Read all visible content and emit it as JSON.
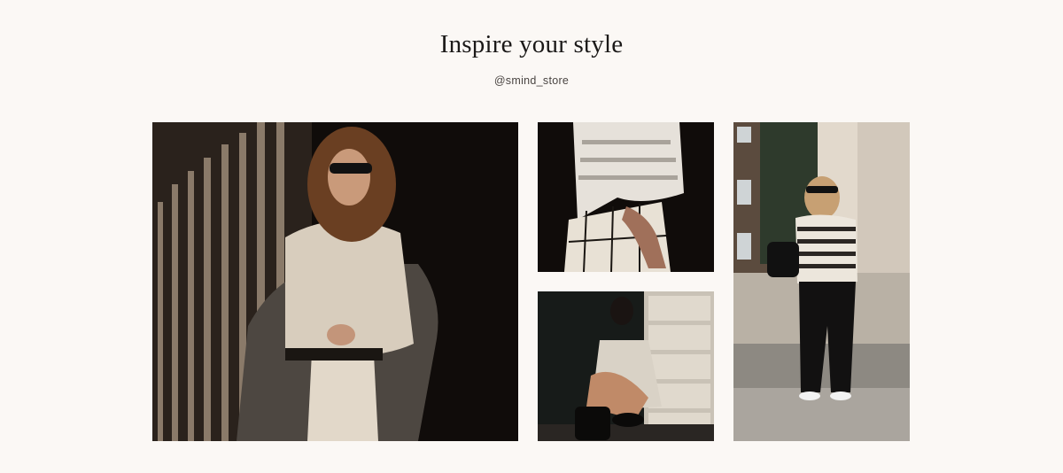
{
  "section": {
    "title": "Inspire your style",
    "handle": "@smind_store"
  },
  "gallery": [
    {
      "subject": "woman in cream lace-up sweater with grey coat against striped shadows"
    },
    {
      "subject": "close-up of knit sweater and checked trousers in striped light"
    },
    {
      "subject": "woman crouching in crochet dress by stone wall"
    },
    {
      "subject": "woman in striped sweater and black trousers on city street"
    }
  ],
  "colors": {
    "background": "#fbf8f5",
    "text": "#1b1918",
    "muted_text": "#4a4542"
  }
}
